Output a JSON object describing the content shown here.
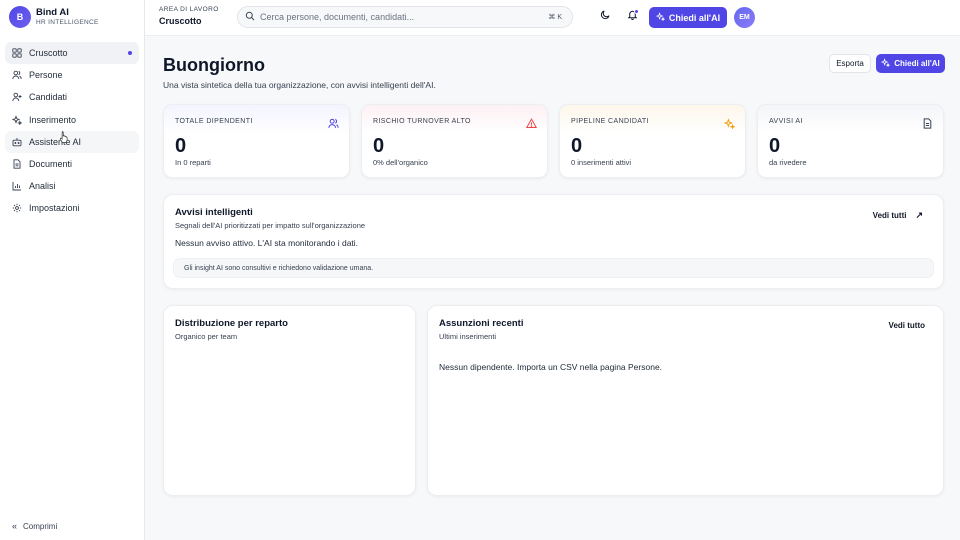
{
  "brand": {
    "initial": "B",
    "name": "Bind AI",
    "tagline": "HR INTELLIGENCE"
  },
  "sidebar": {
    "items": [
      {
        "label": "Cruscotto",
        "icon": "dashboard-icon",
        "active": true
      },
      {
        "label": "Persone",
        "icon": "users-icon"
      },
      {
        "label": "Candidati",
        "icon": "user-plus-icon"
      },
      {
        "label": "Inserimento",
        "icon": "sparkles-icon"
      },
      {
        "label": "Assistente AI",
        "icon": "bot-icon"
      },
      {
        "label": "Documenti",
        "icon": "document-icon"
      },
      {
        "label": "Analisi",
        "icon": "chart-icon"
      },
      {
        "label": "Impostazioni",
        "icon": "gear-icon"
      }
    ],
    "collapse_label": "Comprimi"
  },
  "topbar": {
    "workspace_label": "AREA DI LAVORO",
    "workspace_title": "Cruscotto",
    "search_placeholder": "Cerca persone, documenti, candidati...",
    "search_shortcut": "⌘ K",
    "ask_ai_label": "Chiedi all'AI",
    "avatar_initials": "EM"
  },
  "header": {
    "greeting": "Buongiorno",
    "subtitle": "Una vista sintetica della tua organizzazione, con avvisi intelligenti dell'AI.",
    "export_label": "Esporta",
    "ask_ai_label": "Chiedi all'AI"
  },
  "kpis": [
    {
      "label": "TOTALE DIPENDENTI",
      "value": "0",
      "sub": "In 0 reparti",
      "icon": "users-icon"
    },
    {
      "label": "RISCHIO TURNOVER ALTO",
      "value": "0",
      "sub": "0% dell'organico",
      "icon": "warning-icon"
    },
    {
      "label": "PIPELINE CANDIDATI",
      "value": "0",
      "sub": "0 inserimenti attivi",
      "icon": "sparkles-icon"
    },
    {
      "label": "AVVISI AI",
      "value": "0",
      "sub": "da rivedere",
      "icon": "document-icon"
    }
  ],
  "alerts": {
    "title": "Avvisi intelligenti",
    "subtitle": "Segnali dell'AI prioritizzati per impatto sull'organizzazione",
    "link": "Vedi tutti",
    "empty": "Nessun avviso attivo. L'AI sta monitorando i dati.",
    "disclaimer": "Gli insight AI sono consultivi e richiedono validazione umana."
  },
  "distribution": {
    "title": "Distribuzione per reparto",
    "subtitle": "Organico per team"
  },
  "recent_hires": {
    "title": "Assunzioni recenti",
    "subtitle": "Ultimi inserimenti",
    "link": "Vedi tutto",
    "empty": "Nessun dipendente. Importa un CSV nella pagina Persone."
  },
  "colors": {
    "accent": "#4f46e5",
    "warning": "#ef4444",
    "sparkle": "#f59e0b"
  }
}
